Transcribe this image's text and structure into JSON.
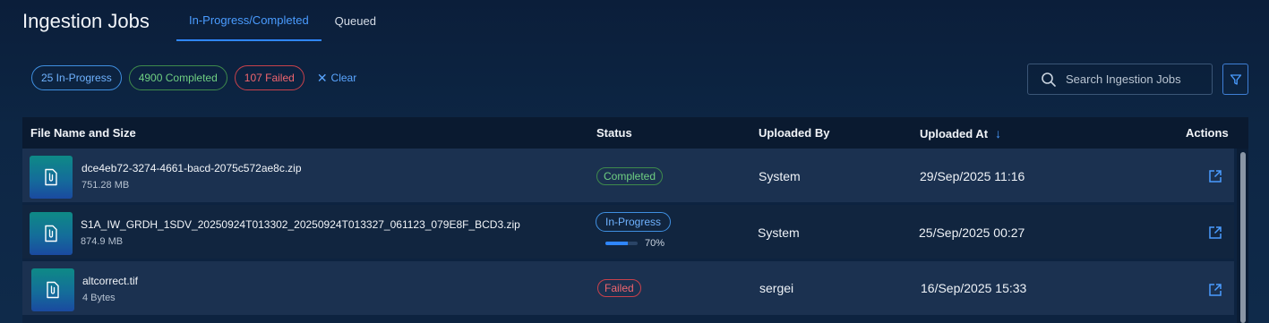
{
  "page": {
    "title": "Ingestion Jobs"
  },
  "tabs": [
    {
      "label": "In-Progress/Completed",
      "active": true
    },
    {
      "label": "Queued",
      "active": false
    }
  ],
  "filters": {
    "in_progress": "25 In-Progress",
    "completed": "4900 Completed",
    "failed": "107 Failed",
    "clear": "Clear"
  },
  "search": {
    "placeholder": "Search Ingestion Jobs",
    "value": ""
  },
  "table": {
    "columns": {
      "file": "File Name and Size",
      "status": "Status",
      "uploaded_by": "Uploaded By",
      "uploaded_at": "Uploaded At",
      "actions": "Actions"
    },
    "sort_indicator": "↓",
    "rows": [
      {
        "file_name": "dce4eb72-3274-4661-bacd-2075c572ae8c.zip",
        "file_size": "751.28 MB",
        "status": "Completed",
        "uploaded_by": "System",
        "uploaded_at": "29/Sep/2025 11:16"
      },
      {
        "file_name": "S1A_IW_GRDH_1SDV_20250924T013302_20250924T013327_061123_079E8F_BCD3.zip",
        "file_size": "874.9 MB",
        "status": "In-Progress",
        "progress": 0.7,
        "progress_label": "70%",
        "uploaded_by": "System",
        "uploaded_at": "25/Sep/2025 00:27"
      },
      {
        "file_name": "altcorrect.tif",
        "file_size": "4 Bytes",
        "status": "Failed",
        "uploaded_by": "sergei",
        "uploaded_at": "16/Sep/2025 15:33"
      }
    ]
  },
  "icons": {
    "file": "paperclip-document-icon",
    "action": "open-external-icon",
    "search": "search-icon",
    "filter": "filter-icon"
  },
  "colors": {
    "accent": "#2f86ff",
    "completed": "#6fcf82",
    "in_progress": "#6fb2ff",
    "failed": "#f0656e"
  }
}
